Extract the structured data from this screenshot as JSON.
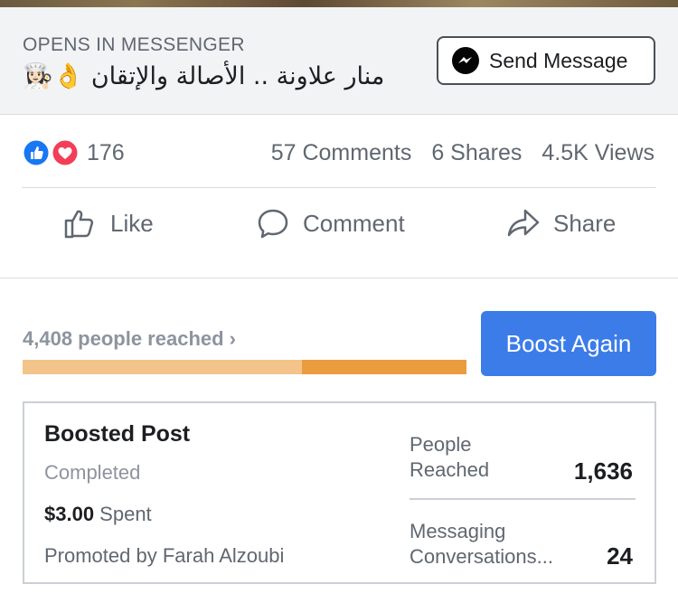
{
  "cta": {
    "subtitle": "OPENS IN MESSENGER",
    "title": "👩🏻‍🍳👌 منار علاونة .. الأصالة والإتقان",
    "send_label": "Send Message"
  },
  "stats": {
    "reactions": "176",
    "comments": "57 Comments",
    "shares": "6 Shares",
    "views": "4.5K Views"
  },
  "actions": {
    "like": "Like",
    "comment": "Comment",
    "share": "Share"
  },
  "reach": {
    "text": "4,408 people reached ›",
    "light_fraction": 0.63,
    "boost_label": "Boost Again"
  },
  "card": {
    "title": "Boosted Post",
    "status": "Completed",
    "spent_amount": "$3.00",
    "spent_label": " Spent",
    "promoted": "Promoted by Farah Alzoubi",
    "metric1_label": "People Reached",
    "metric1_value": "1,636",
    "metric2_label_line1": "Messaging",
    "metric2_label_line2": "Conversations...",
    "metric2_value": "24"
  },
  "colors": {
    "accent": "#3b7ce9",
    "progress_light": "#f3c489",
    "progress_dark": "#ea9c3e",
    "like_blue": "#1877f2",
    "love_red": "#f33e58"
  },
  "icons": {
    "messenger": "messenger-icon",
    "like_reaction": "like-reaction-icon",
    "love_reaction": "love-reaction-icon",
    "like": "thumbs-up-icon",
    "comment": "comment-bubble-icon",
    "share": "share-arrow-icon"
  }
}
